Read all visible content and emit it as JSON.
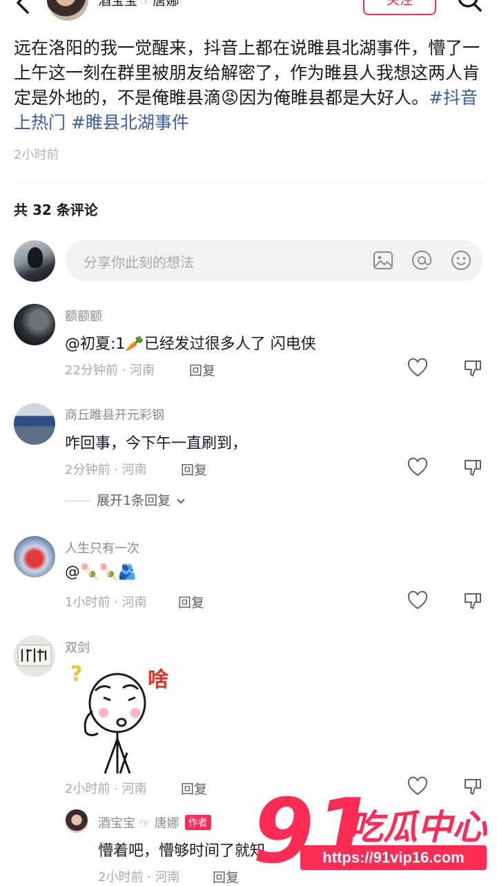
{
  "header": {
    "username": "酒宝宝",
    "username_tag": "☞",
    "partner": "唐娜",
    "follow_label": "关注"
  },
  "post": {
    "text": "远在洛阳的我一觉醒来，抖音上都在说睢县北湖事件，懵了一上午这一刻在群里被朋友给解密了，作为睢县人我想这两人肯定是外地的，不是俺睢县滴😡因为俺睢县都是大好人。",
    "hashtags": [
      "#抖音上热门",
      "#睢县北湖事件"
    ],
    "time": "2小时前"
  },
  "comments_header": {
    "count_label": "共 32 条评论"
  },
  "input": {
    "placeholder": "分享你此刻的想法"
  },
  "comments": [
    {
      "name": "额额额",
      "text": "@初夏:1🥕已经发过很多人了 闪电侠",
      "meta": "22分钟前 · 河南",
      "reply": "回复"
    },
    {
      "name": "商丘睢县开元彩钢",
      "text": "咋回事，今下午一直刷到，",
      "meta": "2分钟前 · 河南",
      "reply": "回复",
      "expand": "展开1条回复"
    },
    {
      "name": "人生只有一次",
      "text": "@🍡🍡🫂",
      "meta": "1小时前 · 河南",
      "reply": "回复"
    },
    {
      "name": "双剑",
      "sticker_text": "啥",
      "meta": "2小时前 · 河南",
      "reply": "回复"
    }
  ],
  "author_reply": {
    "name": "酒宝宝",
    "tag_symbol": "☞",
    "partner": "唐娜",
    "author_badge": "作者",
    "text": "懵着吧，懵够时间了就知",
    "meta": "2小时前 · 河南",
    "reply": "回复"
  },
  "watermark": {
    "number": "91",
    "brand": "吃瓜中心",
    "url": "https://91vip16.com"
  },
  "colors": {
    "accent": "#fe2c55",
    "hashtag": "#3a5cb8",
    "muted": "#a8a9ad"
  }
}
